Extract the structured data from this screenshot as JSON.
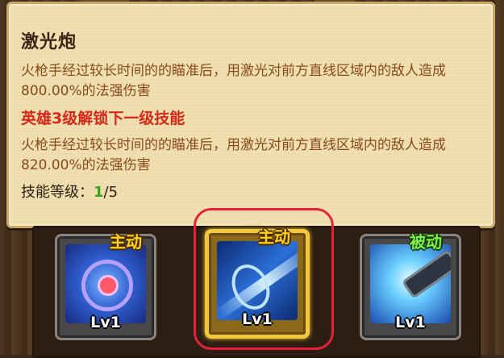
{
  "tooltip": {
    "skill_name": "激光炮",
    "current_desc": "火枪手经过较长时间的的瞄准后，用激光对前方直线区域内的敌人造成800.00%的法强伤害",
    "unlock_text": "英雄3级解锁下一级技能",
    "next_desc": "火枪手经过较长时间的的瞄准后，用激光对前方直线区域内的敌人造成820.00%的法强伤害",
    "level_label": "技能等级：",
    "level_current": "1",
    "level_max": "/5"
  },
  "skills": [
    {
      "type_label": "主动",
      "level": "Lv1",
      "icon": "crosshair-icon"
    },
    {
      "type_label": "主动",
      "level": "Lv1",
      "icon": "laser-beam-icon"
    },
    {
      "type_label": "被动",
      "level": "Lv1",
      "icon": "cannon-icon"
    }
  ],
  "colors": {
    "parchment": "#f0dfb0",
    "desc_text": "#8a4a1c",
    "unlock_text": "#d4281a",
    "level_green": "#3aa21a",
    "active_badge": "#ffd21a",
    "passive_badge": "#7ef04a",
    "highlight_red": "#e8203a"
  }
}
